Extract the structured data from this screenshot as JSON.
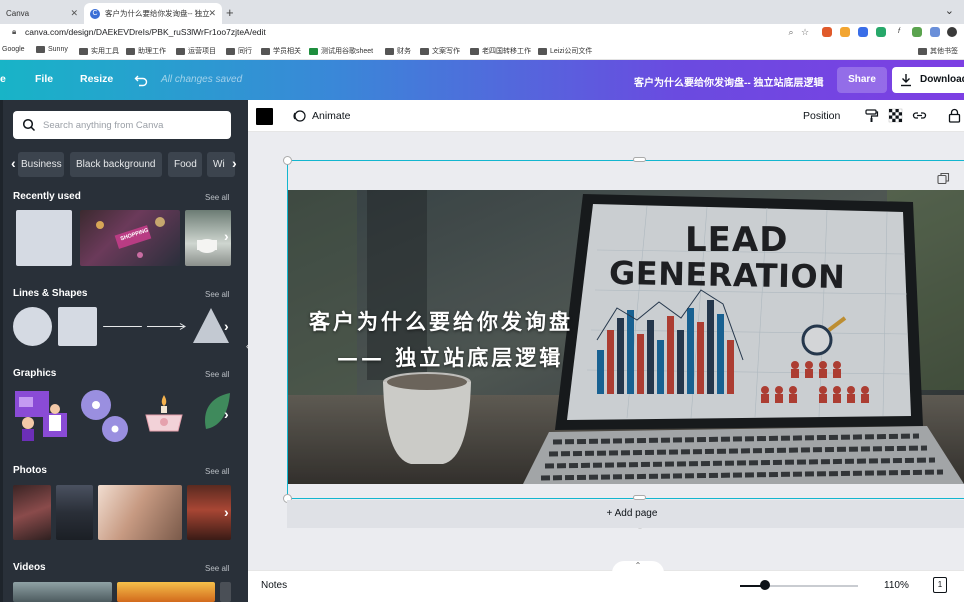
{
  "browser": {
    "tabs": [
      {
        "label": "Canva",
        "active": false
      },
      {
        "label": "客户为什么要给你发询盘-- 独立",
        "active": true
      }
    ],
    "new_tab_symbol": "+",
    "url": "canva.com/design/DAEkEVDreIs/PBK_ruS3lWrFr1oo7zjteA/edit",
    "bookmarks": [
      "Google",
      "Sunny",
      "实用工具",
      "助理工作",
      "运营项目",
      "同行",
      "学员相关",
      "测试用谷歌sheet",
      "财务",
      "文案写作",
      "老四国转移工作",
      "Leizi公司文件"
    ],
    "bookmarks_right": "其他书签"
  },
  "header": {
    "home": "e",
    "file": "File",
    "resize": "Resize",
    "status": "All changes saved",
    "doc_title": "客户为什么要给你发询盘-- 独立站底层逻辑",
    "share": "Share",
    "download": "Download"
  },
  "sidebar": {
    "search_placeholder": "Search anything from Canva",
    "chips": [
      "Business",
      "Black background",
      "Food",
      "Wi"
    ],
    "see_all": "See all",
    "sections": {
      "recent": "Recently used",
      "lines": "Lines & Shapes",
      "graphics": "Graphics",
      "photos": "Photos",
      "videos": "Videos"
    },
    "neon_text": "SHOPPING"
  },
  "toolbar": {
    "animate": "Animate",
    "position": "Position"
  },
  "canvas": {
    "line1": "客户为什么要给你发询盘",
    "line2": "—— 独立站底层逻辑",
    "screen_line1": "LEAD",
    "screen_line2": "GENERATION",
    "add_page": "+ Add page"
  },
  "footer": {
    "notes": "Notes",
    "zoom": "110%",
    "zoom_level": 0.2,
    "page_count": "1"
  },
  "colors": {
    "accent": "#13b6cf",
    "panel": "#293039",
    "gradient_start": "#18b4c7",
    "gradient_end": "#7d3fe3"
  }
}
